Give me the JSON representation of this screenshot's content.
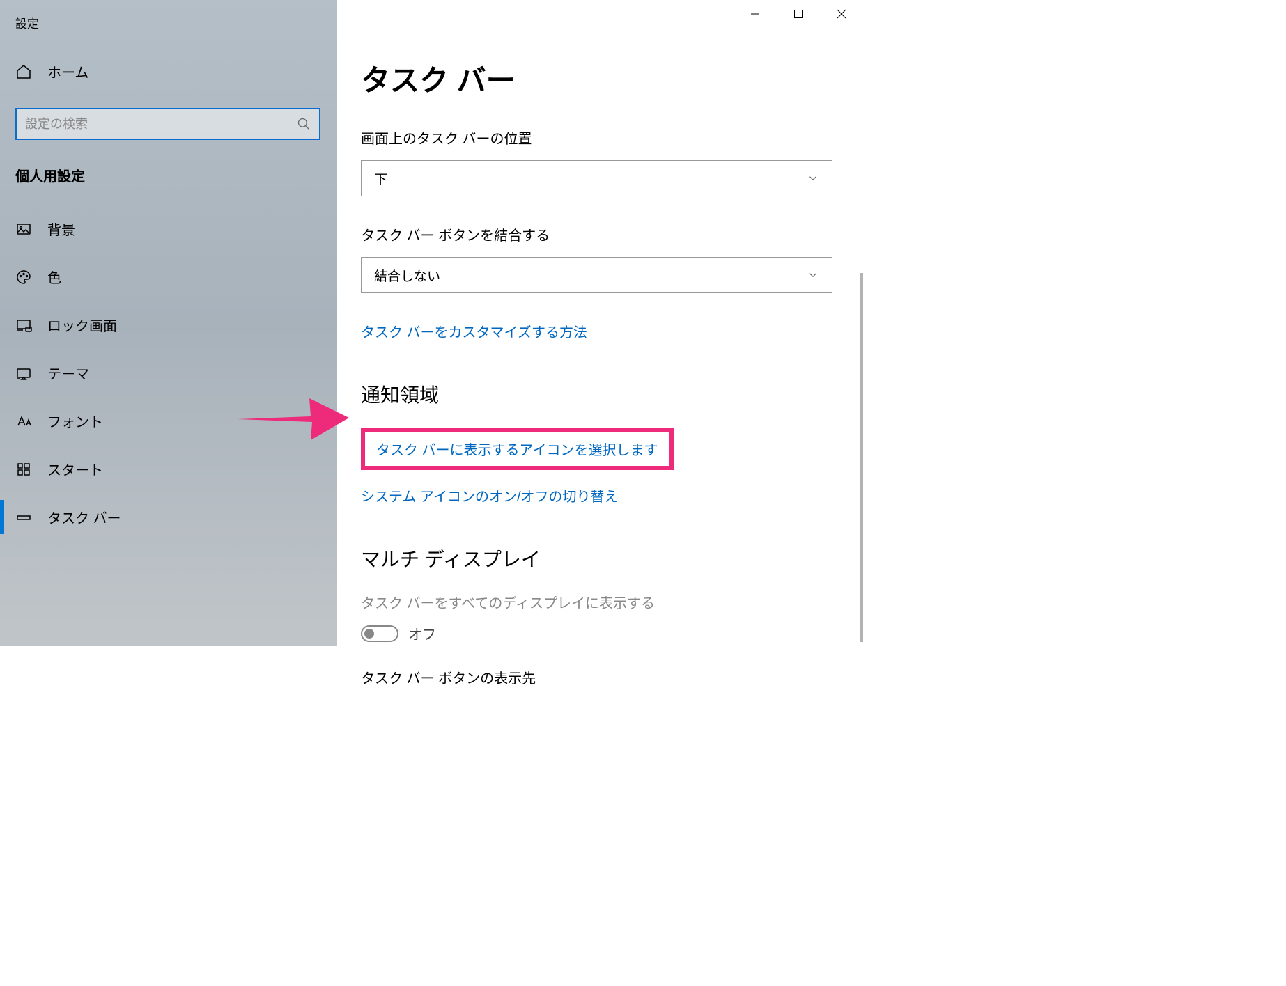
{
  "app": {
    "title": "設定"
  },
  "sidebar": {
    "home": "ホーム",
    "search_placeholder": "設定の検索",
    "section": "個人用設定",
    "items": [
      {
        "label": "背景",
        "icon": "image-icon"
      },
      {
        "label": "色",
        "icon": "palette-icon"
      },
      {
        "label": "ロック画面",
        "icon": "lock-screen-icon"
      },
      {
        "label": "テーマ",
        "icon": "theme-icon"
      },
      {
        "label": "フォント",
        "icon": "font-icon"
      },
      {
        "label": "スタート",
        "icon": "start-icon"
      },
      {
        "label": "タスク バー",
        "icon": "taskbar-icon",
        "active": true
      }
    ]
  },
  "main": {
    "title": "タスク バー",
    "position_label": "画面上のタスク バーの位置",
    "position_value": "下",
    "combine_label": "タスク バー ボタンを結合する",
    "combine_value": "結合しない",
    "customize_link": "タスク バーをカスタマイズする方法",
    "notification_heading": "通知領域",
    "select_icons_link": "タスク バーに表示するアイコンを選択します",
    "system_icons_link": "システム アイコンのオン/オフの切り替え",
    "multi_display_heading": "マルチ ディスプレイ",
    "multi_display_label": "タスク バーをすべてのディスプレイに表示する",
    "multi_display_state": "オフ",
    "buttons_display_label": "タスク バー ボタンの表示先"
  },
  "colors": {
    "accent": "#0078d4",
    "link": "#0067c0",
    "highlight": "#ee2a7b"
  }
}
